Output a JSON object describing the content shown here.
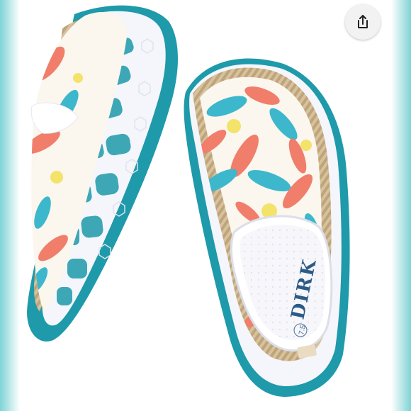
{
  "image": {
    "subject": "floral-print-slip-on-sneakers",
    "insole_brand": "DIRK",
    "insole_size": "7.5"
  },
  "share_button": {
    "icon": "share-icon",
    "color": "#222222"
  },
  "colors": {
    "sole_teal": "#1e9aaa",
    "sole_white": "#f4f6fb",
    "jute_trim": "#cdb48c",
    "print_coral": "#f07e6a",
    "print_turquoise": "#3cb7cc",
    "print_yellow": "#f3e36a",
    "brand_blue": "#2d5b86"
  }
}
